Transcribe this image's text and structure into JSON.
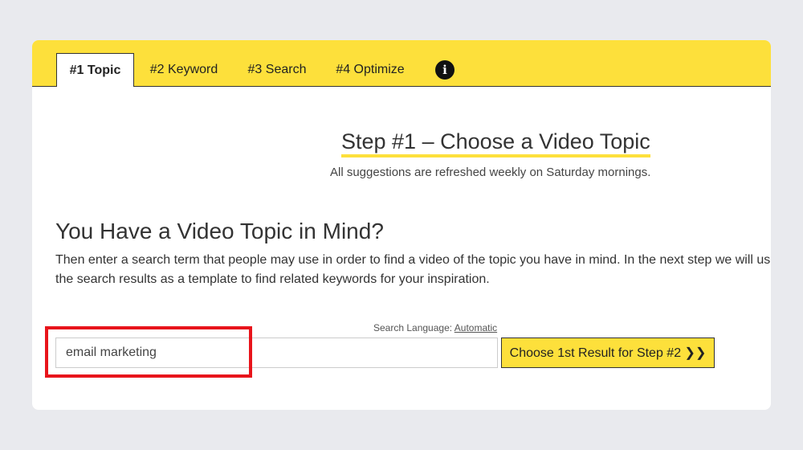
{
  "tabs": [
    {
      "label": "#1 Topic",
      "active": true
    },
    {
      "label": "#2 Keyword",
      "active": false
    },
    {
      "label": "#3 Search",
      "active": false
    },
    {
      "label": "#4 Optimize",
      "active": false
    }
  ],
  "info_icon": {
    "glyph": "i",
    "icon": "info-icon"
  },
  "step": {
    "title": "Step #1 – Choose a Video Topic",
    "subtitle": "All suggestions are refreshed weekly on Saturday mornings."
  },
  "section": {
    "heading": "You Have a Video Topic in Mind?",
    "description": "Then enter a search term that people may use in order to find a video of the topic you have in mind. In the next step we will use the search results as a template to find related keywords for your inspiration."
  },
  "search": {
    "language_label": "Search Language:",
    "language_value": "Automatic",
    "input_value": "email marketing",
    "button_label": "Choose 1st Result for Step #2 ❯❯"
  },
  "colors": {
    "accent": "#fde03b",
    "highlight": "#e8141b",
    "background": "#e9eaee"
  }
}
